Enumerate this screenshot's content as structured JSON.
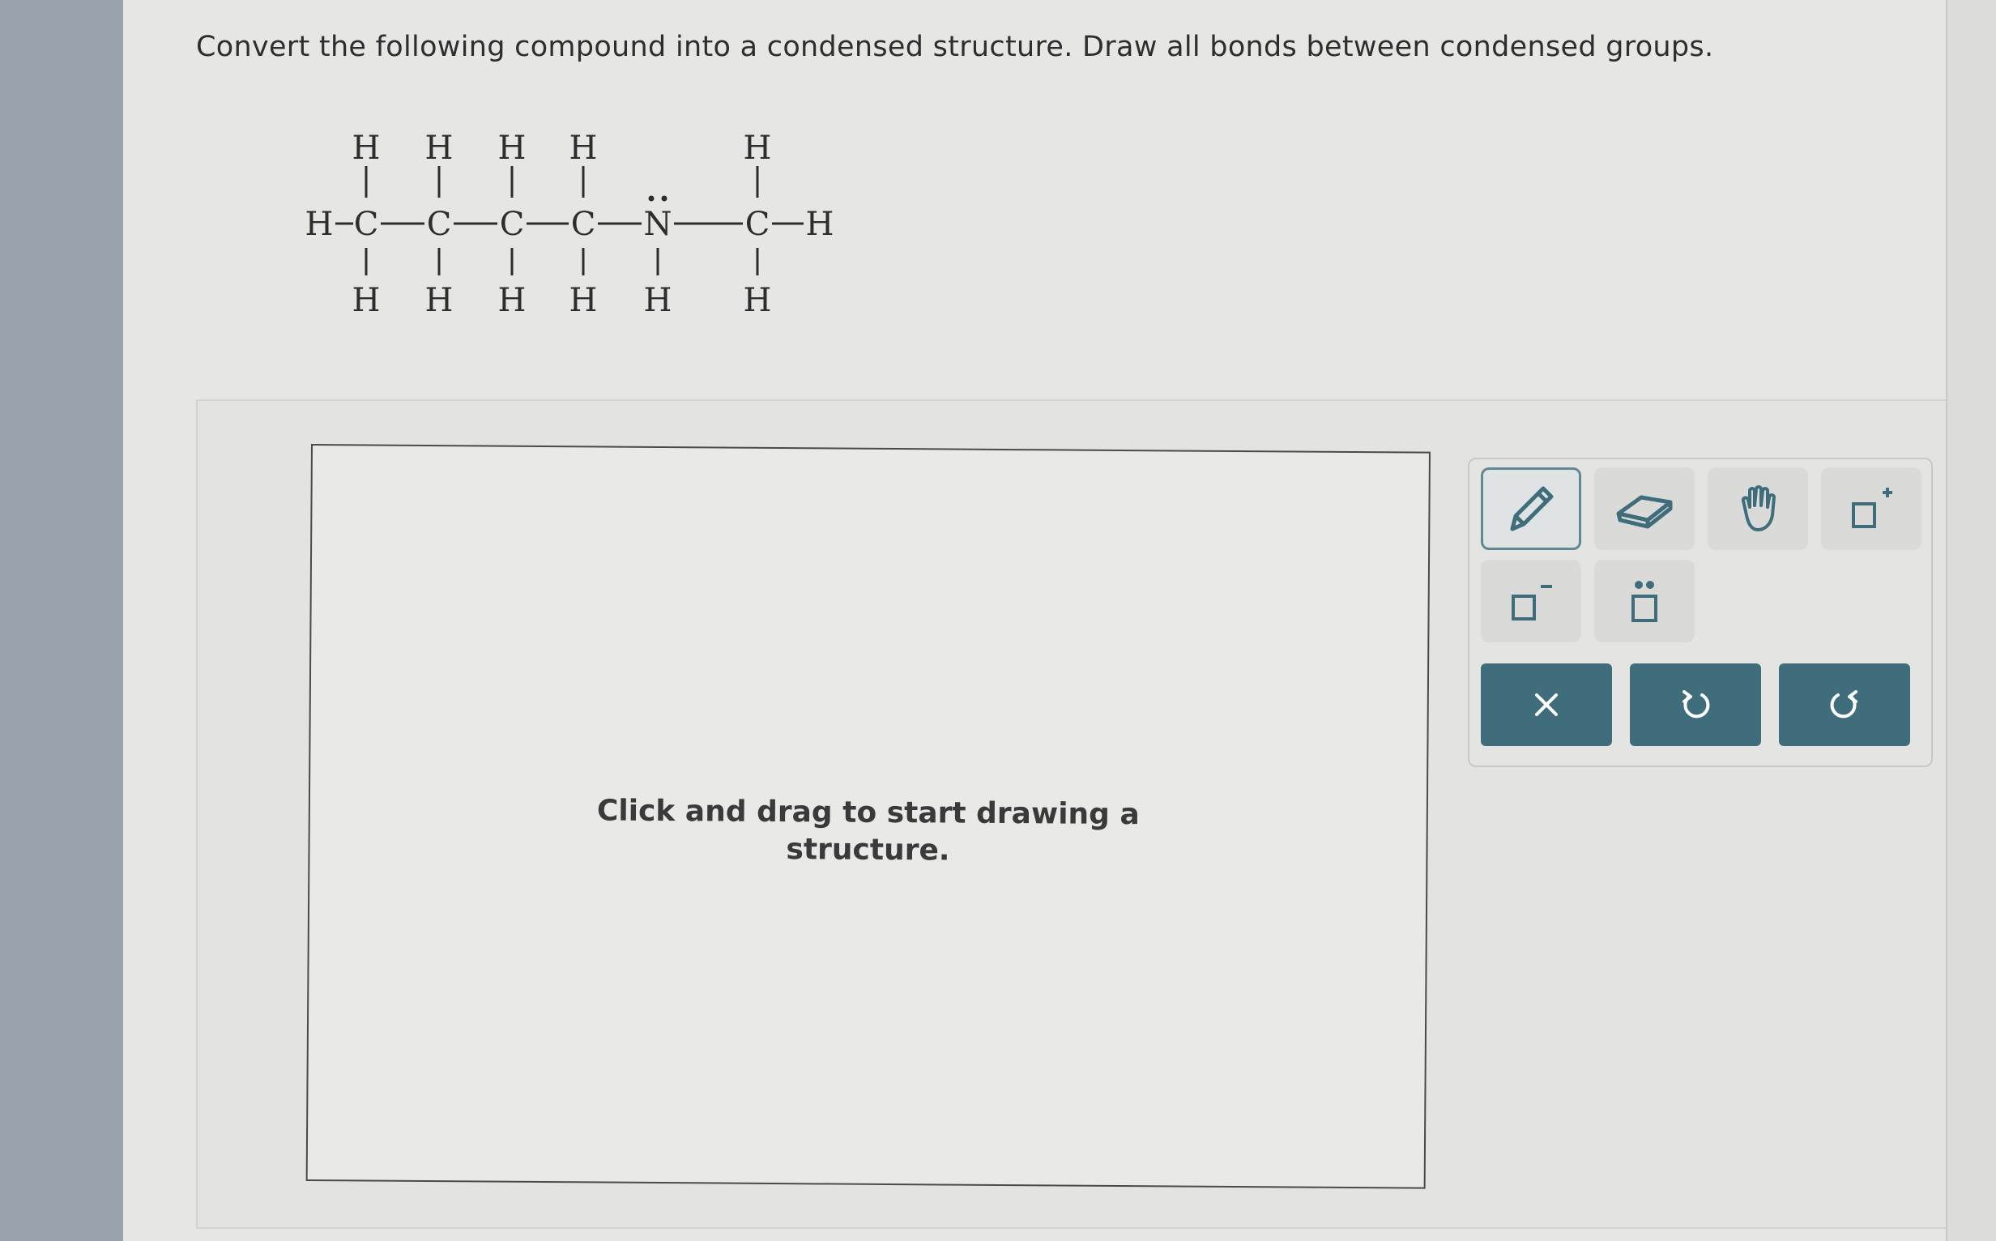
{
  "question": {
    "text": "Convert the following compound into a condensed structure. Draw all bonds between condensed groups."
  },
  "molecule": {
    "top_h": [
      "H",
      "H",
      "H",
      "H",
      "H"
    ],
    "chain": [
      "H",
      "C",
      "C",
      "C",
      "C",
      "N",
      "C",
      "H"
    ],
    "bottom_h": [
      "H",
      "H",
      "H",
      "H",
      "H",
      "H"
    ],
    "lone_pair": ":"
  },
  "canvas": {
    "hint_line1": "Click and drag to start drawing a",
    "hint_line2": "structure."
  },
  "toolbox": {
    "tools": [
      {
        "name": "pencil-icon",
        "active": true
      },
      {
        "name": "eraser-icon",
        "active": false
      },
      {
        "name": "hand-icon",
        "active": false
      },
      {
        "name": "add-charge-positive-icon",
        "active": false
      },
      {
        "name": "add-charge-negative-icon",
        "active": false
      },
      {
        "name": "lone-pair-icon",
        "active": false
      }
    ],
    "actions": [
      {
        "name": "clear-icon"
      },
      {
        "name": "undo-icon"
      },
      {
        "name": "redo-icon"
      }
    ],
    "accent_color": "#3f6d7b"
  }
}
